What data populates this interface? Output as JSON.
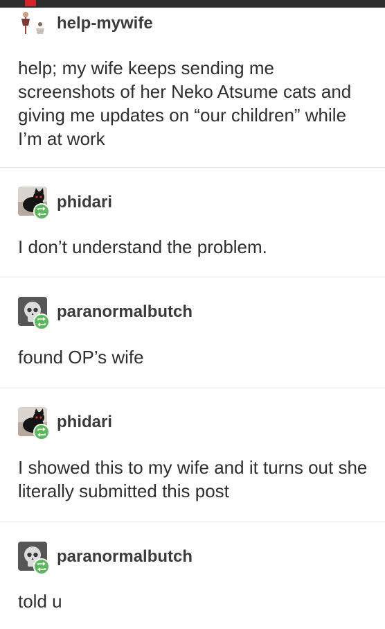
{
  "thread": {
    "op": {
      "username": "help-mywife",
      "text": "help; my wife keeps sending me screenshots of her Neko Atsume cats and giving me updates on “our children” while I’m at work"
    },
    "replies": [
      {
        "username": "phidari",
        "text": "I don’t understand the problem.",
        "avatar": "black-cat-avatar"
      },
      {
        "username": "paranormalbutch",
        "text": "found OP’s wife",
        "avatar": "skull-avatar"
      },
      {
        "username": "phidari",
        "text": "I showed this to my wife and it turns out she literally submitted this post",
        "avatar": "black-cat-avatar"
      },
      {
        "username": "paranormalbutch",
        "text": "told u",
        "avatar": "skull-avatar"
      }
    ]
  },
  "colors": {
    "reblog_badge": "#5cb85c",
    "top_bar": "#2d2d2d",
    "divider": "#e7e7e7"
  }
}
